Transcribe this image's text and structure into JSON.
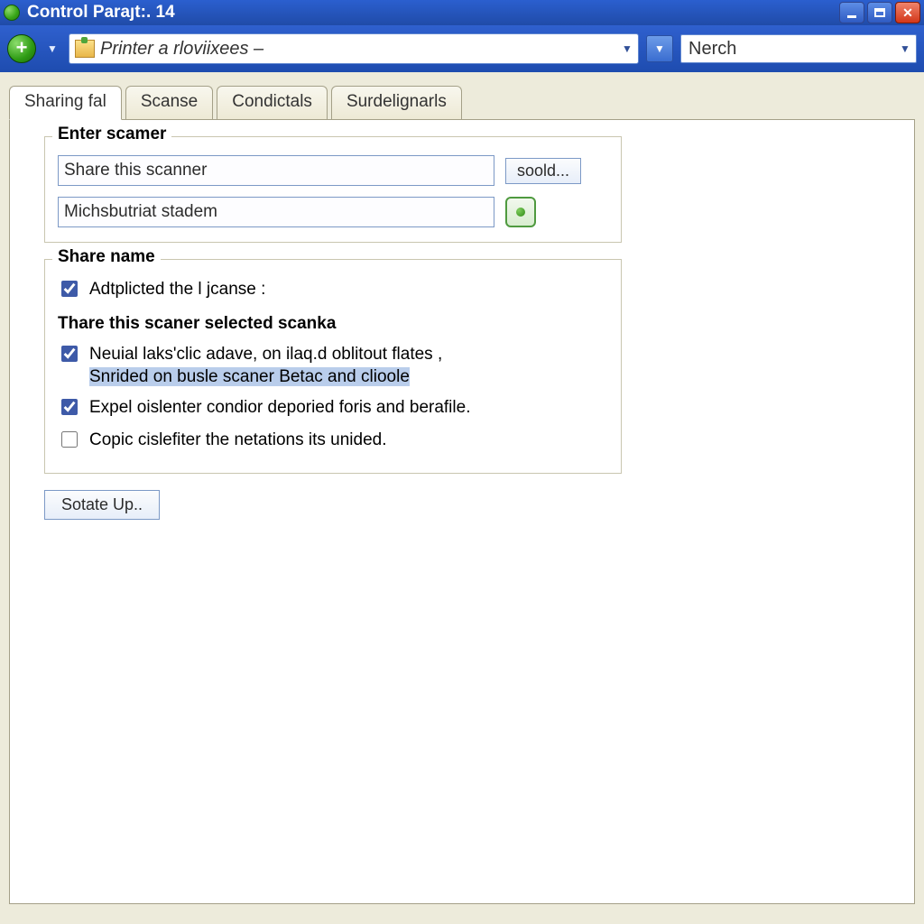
{
  "window": {
    "title": "Control  Paraȷt:. 14"
  },
  "toolbar": {
    "combo_text": "Printer a rloviixees –",
    "search_text": "Nerch"
  },
  "tabs": [
    {
      "label": "Sharing fal",
      "active": true
    },
    {
      "label": "Scanse",
      "active": false
    },
    {
      "label": "Condictals",
      "active": false
    },
    {
      "label": "Surdelignarls",
      "active": false
    }
  ],
  "group1": {
    "legend": "Enter scamer",
    "field1_value": "Share this scanner",
    "field2_value": "Michsbutriat stadem",
    "sold_label": "soold..."
  },
  "group2": {
    "legend": "Share name",
    "check1_label": "Adtplicted the l jcanse :",
    "sublegend": "Thare this scaner selected scanka",
    "check2_line1": "Neuial laks'clic adave, on ilaq.d oblitout flates ,",
    "check2_line2": "Snrided on busle scaner Betac and clioole",
    "check3_label": "Expel oislenter condior deporied foris and berafile.",
    "check4_label": "Copic cislefiter the netations its unided."
  },
  "buttons": {
    "sotate_up": "Sotate Up.."
  },
  "colors": {
    "titlebar_blue": "#2454B7",
    "panel_bg": "#EDEBDB",
    "field_border": "#7C99C6",
    "highlight": "#B9CDEB"
  }
}
